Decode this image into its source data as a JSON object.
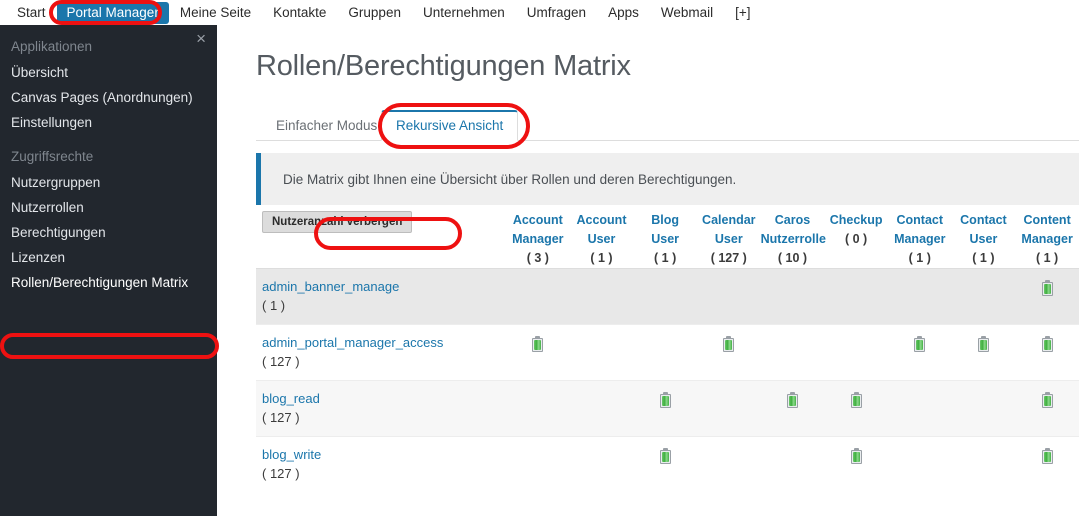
{
  "topnav": {
    "items": [
      {
        "label": "Start",
        "active": false
      },
      {
        "label": "Portal Manager",
        "active": true
      },
      {
        "label": "Meine Seite",
        "active": false
      },
      {
        "label": "Kontakte",
        "active": false
      },
      {
        "label": "Gruppen",
        "active": false
      },
      {
        "label": "Unternehmen",
        "active": false
      },
      {
        "label": "Umfragen",
        "active": false
      },
      {
        "label": "Apps",
        "active": false
      },
      {
        "label": "Webmail",
        "active": false
      },
      {
        "label": "[+]",
        "active": false
      }
    ],
    "active_color": "#1b76ab"
  },
  "sidebar": {
    "close_label": "×",
    "groups": [
      {
        "label": "Applikationen",
        "items": [
          {
            "label": "Übersicht",
            "selected": false
          },
          {
            "label": "Canvas Pages (Anordnungen)",
            "selected": false
          },
          {
            "label": "Einstellungen",
            "selected": false
          }
        ]
      },
      {
        "label": "Zugriffsrechte",
        "items": [
          {
            "label": "Nutzergruppen",
            "selected": false
          },
          {
            "label": "Nutzerrollen",
            "selected": false
          },
          {
            "label": "Berechtigungen",
            "selected": false
          },
          {
            "label": "Lizenzen",
            "selected": false
          },
          {
            "label": "Rollen/Berechtigungen Matrix",
            "selected": true
          }
        ]
      }
    ]
  },
  "main": {
    "page_title": "Rollen/Berechtigungen Matrix",
    "tabs": [
      {
        "label": "Einfacher Modus",
        "active": false
      },
      {
        "label": "Rekursive Ansicht",
        "active": true
      }
    ],
    "info_text": "Die Matrix gibt Ihnen eine Übersicht über Rollen und deren Berechtigungen.",
    "info_accent": "#1b76ab"
  },
  "matrix": {
    "toggle_button_label": "Nutzeranzahl verbergen",
    "columns": [
      {
        "name": "Account",
        "name2": "Manager",
        "count": "( 3 )"
      },
      {
        "name": "Account",
        "name2": "User",
        "count": "( 1 )"
      },
      {
        "name": "Blog",
        "name2": "User",
        "count": "( 1 )"
      },
      {
        "name": "Calendar",
        "name2": "User",
        "count": "( 127 )"
      },
      {
        "name": "Caros",
        "name2": "Nutzerrolle",
        "count": "( 10 )"
      },
      {
        "name": "Checkup",
        "name2": "",
        "count": "( 0 )"
      },
      {
        "name": "Contact",
        "name2": "Manager",
        "count": "( 1 )"
      },
      {
        "name": "Contact",
        "name2": "User",
        "count": "( 1 )"
      },
      {
        "name": "Content",
        "name2": "Manager",
        "count": "( 1 )"
      }
    ],
    "rows": [
      {
        "permission": "admin_banner_manage",
        "count": "( 1 )",
        "grants": [
          false,
          false,
          false,
          false,
          false,
          false,
          false,
          false,
          true
        ]
      },
      {
        "permission": "admin_portal_manager_access",
        "count": "( 127 )",
        "grants": [
          true,
          false,
          false,
          true,
          false,
          false,
          true,
          true,
          true
        ]
      },
      {
        "permission": "blog_read",
        "count": "( 127 )",
        "grants": [
          false,
          false,
          true,
          false,
          true,
          true,
          false,
          false,
          true
        ]
      },
      {
        "permission": "blog_write",
        "count": "( 127 )",
        "grants": [
          false,
          false,
          true,
          false,
          false,
          true,
          false,
          false,
          true
        ]
      }
    ],
    "grant_icon": "battery-full-icon"
  },
  "annotations": {
    "color": "#ee1111",
    "marks": [
      {
        "target": "topnav-portal-manager"
      },
      {
        "target": "tab-rekursive-ansicht"
      },
      {
        "target": "toggle-usercount-button"
      },
      {
        "target": "sidebar-item-rollen-berechtigungen-matrix"
      }
    ]
  }
}
